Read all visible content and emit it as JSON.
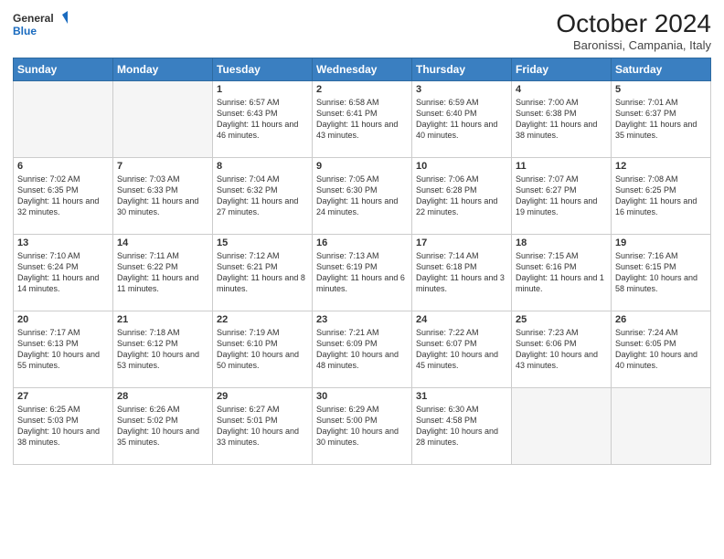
{
  "header": {
    "logo_general": "General",
    "logo_blue": "Blue",
    "month_title": "October 2024",
    "subtitle": "Baronissi, Campania, Italy"
  },
  "weekdays": [
    "Sunday",
    "Monday",
    "Tuesday",
    "Wednesday",
    "Thursday",
    "Friday",
    "Saturday"
  ],
  "weeks": [
    [
      {
        "day": "",
        "empty": true
      },
      {
        "day": "",
        "empty": true
      },
      {
        "day": "1",
        "sunrise": "6:57 AM",
        "sunset": "6:43 PM",
        "daylight": "11 hours and 46 minutes."
      },
      {
        "day": "2",
        "sunrise": "6:58 AM",
        "sunset": "6:41 PM",
        "daylight": "11 hours and 43 minutes."
      },
      {
        "day": "3",
        "sunrise": "6:59 AM",
        "sunset": "6:40 PM",
        "daylight": "11 hours and 40 minutes."
      },
      {
        "day": "4",
        "sunrise": "7:00 AM",
        "sunset": "6:38 PM",
        "daylight": "11 hours and 38 minutes."
      },
      {
        "day": "5",
        "sunrise": "7:01 AM",
        "sunset": "6:37 PM",
        "daylight": "11 hours and 35 minutes."
      }
    ],
    [
      {
        "day": "6",
        "sunrise": "7:02 AM",
        "sunset": "6:35 PM",
        "daylight": "11 hours and 32 minutes."
      },
      {
        "day": "7",
        "sunrise": "7:03 AM",
        "sunset": "6:33 PM",
        "daylight": "11 hours and 30 minutes."
      },
      {
        "day": "8",
        "sunrise": "7:04 AM",
        "sunset": "6:32 PM",
        "daylight": "11 hours and 27 minutes."
      },
      {
        "day": "9",
        "sunrise": "7:05 AM",
        "sunset": "6:30 PM",
        "daylight": "11 hours and 24 minutes."
      },
      {
        "day": "10",
        "sunrise": "7:06 AM",
        "sunset": "6:28 PM",
        "daylight": "11 hours and 22 minutes."
      },
      {
        "day": "11",
        "sunrise": "7:07 AM",
        "sunset": "6:27 PM",
        "daylight": "11 hours and 19 minutes."
      },
      {
        "day": "12",
        "sunrise": "7:08 AM",
        "sunset": "6:25 PM",
        "daylight": "11 hours and 16 minutes."
      }
    ],
    [
      {
        "day": "13",
        "sunrise": "7:10 AM",
        "sunset": "6:24 PM",
        "daylight": "11 hours and 14 minutes."
      },
      {
        "day": "14",
        "sunrise": "7:11 AM",
        "sunset": "6:22 PM",
        "daylight": "11 hours and 11 minutes."
      },
      {
        "day": "15",
        "sunrise": "7:12 AM",
        "sunset": "6:21 PM",
        "daylight": "11 hours and 8 minutes."
      },
      {
        "day": "16",
        "sunrise": "7:13 AM",
        "sunset": "6:19 PM",
        "daylight": "11 hours and 6 minutes."
      },
      {
        "day": "17",
        "sunrise": "7:14 AM",
        "sunset": "6:18 PM",
        "daylight": "11 hours and 3 minutes."
      },
      {
        "day": "18",
        "sunrise": "7:15 AM",
        "sunset": "6:16 PM",
        "daylight": "11 hours and 1 minute."
      },
      {
        "day": "19",
        "sunrise": "7:16 AM",
        "sunset": "6:15 PM",
        "daylight": "10 hours and 58 minutes."
      }
    ],
    [
      {
        "day": "20",
        "sunrise": "7:17 AM",
        "sunset": "6:13 PM",
        "daylight": "10 hours and 55 minutes."
      },
      {
        "day": "21",
        "sunrise": "7:18 AM",
        "sunset": "6:12 PM",
        "daylight": "10 hours and 53 minutes."
      },
      {
        "day": "22",
        "sunrise": "7:19 AM",
        "sunset": "6:10 PM",
        "daylight": "10 hours and 50 minutes."
      },
      {
        "day": "23",
        "sunrise": "7:21 AM",
        "sunset": "6:09 PM",
        "daylight": "10 hours and 48 minutes."
      },
      {
        "day": "24",
        "sunrise": "7:22 AM",
        "sunset": "6:07 PM",
        "daylight": "10 hours and 45 minutes."
      },
      {
        "day": "25",
        "sunrise": "7:23 AM",
        "sunset": "6:06 PM",
        "daylight": "10 hours and 43 minutes."
      },
      {
        "day": "26",
        "sunrise": "7:24 AM",
        "sunset": "6:05 PM",
        "daylight": "10 hours and 40 minutes."
      }
    ],
    [
      {
        "day": "27",
        "sunrise": "6:25 AM",
        "sunset": "5:03 PM",
        "daylight": "10 hours and 38 minutes."
      },
      {
        "day": "28",
        "sunrise": "6:26 AM",
        "sunset": "5:02 PM",
        "daylight": "10 hours and 35 minutes."
      },
      {
        "day": "29",
        "sunrise": "6:27 AM",
        "sunset": "5:01 PM",
        "daylight": "10 hours and 33 minutes."
      },
      {
        "day": "30",
        "sunrise": "6:29 AM",
        "sunset": "5:00 PM",
        "daylight": "10 hours and 30 minutes."
      },
      {
        "day": "31",
        "sunrise": "6:30 AM",
        "sunset": "4:58 PM",
        "daylight": "10 hours and 28 minutes."
      },
      {
        "day": "",
        "empty": true
      },
      {
        "day": "",
        "empty": true
      }
    ]
  ],
  "labels": {
    "sunrise": "Sunrise:",
    "sunset": "Sunset:",
    "daylight": "Daylight:"
  }
}
